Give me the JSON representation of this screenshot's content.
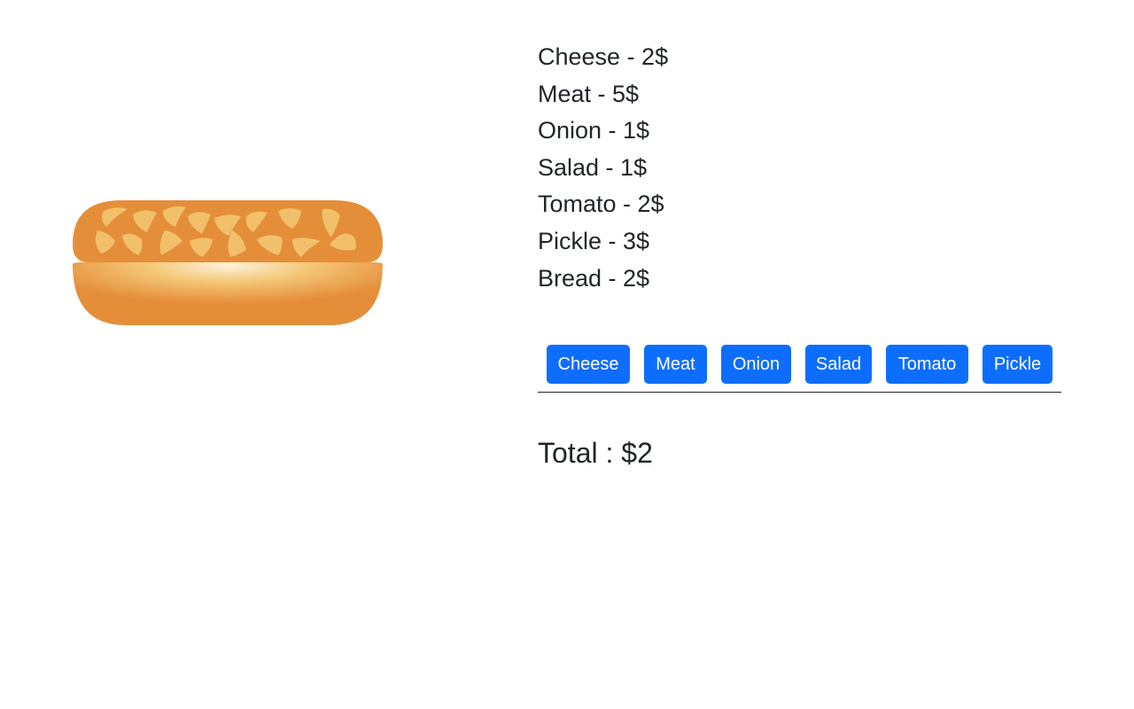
{
  "prices": [
    {
      "label": "Cheese - 2$"
    },
    {
      "label": "Meat - 5$"
    },
    {
      "label": "Onion - 1$"
    },
    {
      "label": "Salad - 1$"
    },
    {
      "label": "Tomato - 2$"
    },
    {
      "label": "Pickle - 3$"
    },
    {
      "label": "Bread - 2$"
    }
  ],
  "buttons": [
    {
      "label": "Cheese"
    },
    {
      "label": "Meat"
    },
    {
      "label": "Onion"
    },
    {
      "label": "Salad"
    },
    {
      "label": "Tomato"
    },
    {
      "label": "Pickle"
    }
  ],
  "total": {
    "text": "Total : $2"
  },
  "colors": {
    "button": "#0d6efd",
    "bun": "#e58e3a",
    "seed": "#f2c06a",
    "text": "#212529"
  }
}
